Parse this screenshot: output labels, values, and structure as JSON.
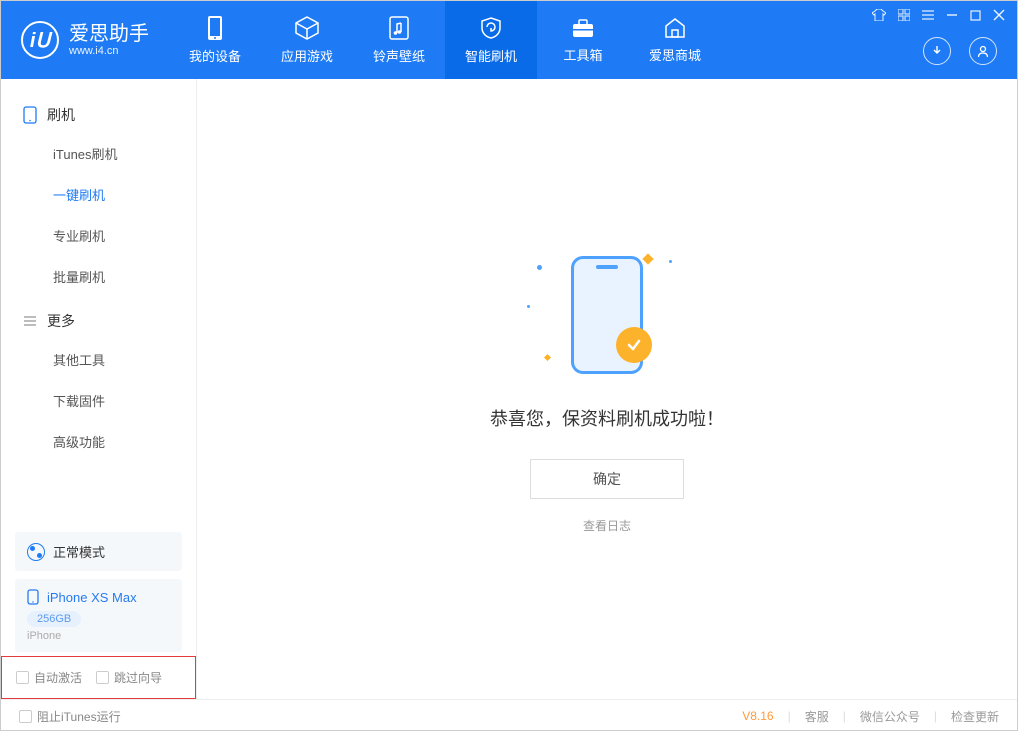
{
  "app": {
    "title": "爱思助手",
    "subtitle": "www.i4.cn"
  },
  "nav": {
    "tabs": [
      {
        "label": "我的设备",
        "icon": "device"
      },
      {
        "label": "应用游戏",
        "icon": "cube"
      },
      {
        "label": "铃声壁纸",
        "icon": "music"
      },
      {
        "label": "智能刷机",
        "icon": "shield",
        "active": true
      },
      {
        "label": "工具箱",
        "icon": "toolbox"
      },
      {
        "label": "爱思商城",
        "icon": "home"
      }
    ]
  },
  "sidebar": {
    "sections": [
      {
        "title": "刷机",
        "items": [
          {
            "label": "iTunes刷机"
          },
          {
            "label": "一键刷机",
            "active": true
          },
          {
            "label": "专业刷机"
          },
          {
            "label": "批量刷机"
          }
        ]
      },
      {
        "title": "更多",
        "items": [
          {
            "label": "其他工具"
          },
          {
            "label": "下载固件"
          },
          {
            "label": "高级功能"
          }
        ]
      }
    ],
    "mode": {
      "label": "正常模式"
    },
    "device": {
      "name": "iPhone XS Max",
      "capacity": "256GB",
      "type": "iPhone"
    },
    "options": {
      "auto_activate": "自动激活",
      "skip_guide": "跳过向导"
    }
  },
  "content": {
    "success_message": "恭喜您，保资料刷机成功啦！",
    "ok_button": "确定",
    "view_log": "查看日志"
  },
  "footer": {
    "block_itunes": "阻止iTunes运行",
    "version": "V8.16",
    "links": [
      "客服",
      "微信公众号",
      "检查更新"
    ]
  }
}
